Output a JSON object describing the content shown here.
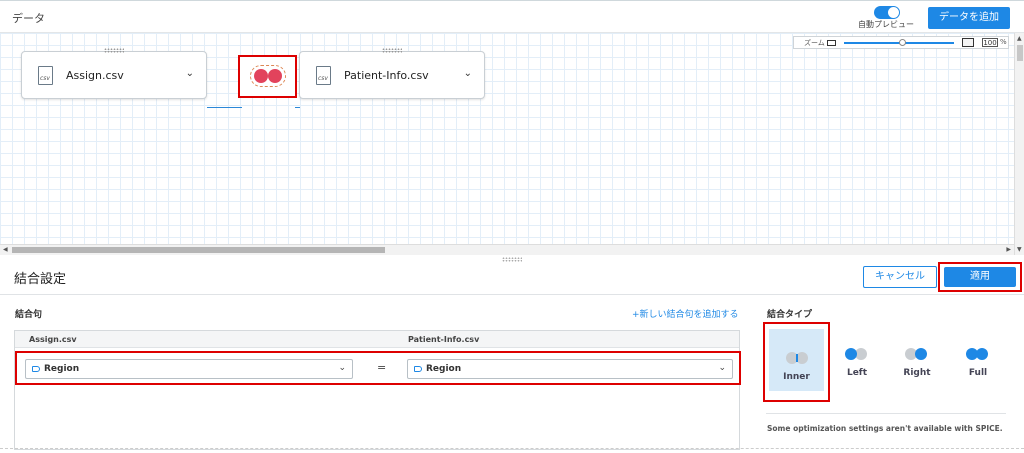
{
  "header": {
    "title": "データ",
    "auto_preview_label": "自動プレビュー",
    "add_data_label": "データを追加"
  },
  "zoom": {
    "label": "ズーム",
    "value": "100",
    "unit": "%"
  },
  "datasets": {
    "left": {
      "label": "Assign.csv",
      "file_type": "csv"
    },
    "right": {
      "label": "Patient-Info.csv",
      "file_type": "csv"
    }
  },
  "join_settings": {
    "title": "結合設定",
    "cancel_label": "キャンセル",
    "apply_label": "適用",
    "clauses_title": "結合句",
    "add_clause_label": "+新しい結合句を追加する",
    "columns": {
      "left": "Assign.csv",
      "right": "Patient-Info.csv"
    },
    "clause": {
      "left_field": "Region",
      "operator": "=",
      "right_field": "Region"
    },
    "join_type_title": "結合タイプ",
    "join_types": [
      {
        "label": "Inner",
        "selected": true
      },
      {
        "label": "Left",
        "selected": false
      },
      {
        "label": "Right",
        "selected": false
      },
      {
        "label": "Full",
        "selected": false
      }
    ],
    "note": "Some optimization settings aren't available with SPICE."
  },
  "colors": {
    "accent": "#1e88e5",
    "join_icon": "#e2435c",
    "highlight": "#dd0000",
    "selected_bg": "#d6e9f8",
    "inactive_circle": "#c9cdd1"
  }
}
